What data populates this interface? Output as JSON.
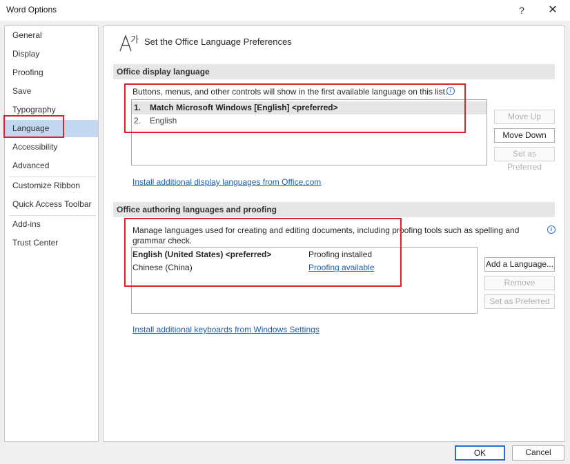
{
  "window": {
    "title": "Word Options",
    "help_label": "?",
    "close_label": "✕"
  },
  "sidebar": {
    "items": [
      {
        "label": "General"
      },
      {
        "label": "Display"
      },
      {
        "label": "Proofing"
      },
      {
        "label": "Save"
      },
      {
        "label": "Typography"
      },
      {
        "label": "Language",
        "selected": true
      },
      {
        "label": "Accessibility"
      },
      {
        "label": "Advanced"
      },
      {
        "label": "Customize Ribbon"
      },
      {
        "label": "Quick Access Toolbar"
      },
      {
        "label": "Add-ins"
      },
      {
        "label": "Trust Center"
      }
    ]
  },
  "main": {
    "page_title": "Set the Office Language Preferences",
    "icon": "language-icon",
    "display_section": {
      "header": "Office display language",
      "description": "Buttons, menus, and other controls will show in the first available language on this list.",
      "languages": [
        {
          "num": "1.",
          "name": "Match Microsoft Windows [English] <preferred>",
          "selected": true
        },
        {
          "num": "2.",
          "name": "English",
          "selected": false
        }
      ],
      "buttons": {
        "move_up": "Move Up",
        "move_down": "Move Down",
        "set_preferred": "Set as Preferred"
      },
      "install_link": "Install additional display languages from Office.com"
    },
    "authoring_section": {
      "header": "Office authoring languages and proofing",
      "description_line1": "Manage languages used for creating and editing documents, including proofing tools such as spelling and",
      "description_line2": "grammar check.",
      "languages": [
        {
          "name": "English (United States) <preferred>",
          "status": "Proofing installed"
        },
        {
          "name": "Chinese (China)",
          "status": "Proofing available"
        }
      ],
      "buttons": {
        "add_language": "Add a Language...",
        "remove": "Remove",
        "set_preferred": "Set as Preferred"
      },
      "install_link": "Install additional keyboards from Windows Settings"
    }
  },
  "footer": {
    "ok_label": "OK",
    "cancel_label": "Cancel"
  },
  "colors": {
    "selected_nav": "#c4d7f0",
    "annotation_red": "#e0202b",
    "link_blue": "#1f5fa6"
  }
}
